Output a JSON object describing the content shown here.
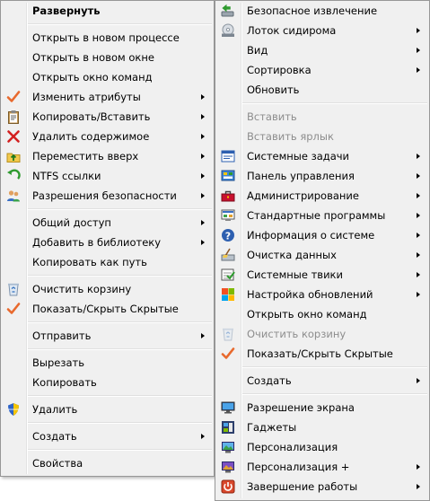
{
  "left_menu": {
    "items": [
      {
        "label": "Развернуть",
        "bold": true
      },
      {
        "sep": true
      },
      {
        "label": "Открыть в новом процессе"
      },
      {
        "label": "Открыть в новом окне"
      },
      {
        "label": "Открыть окно команд"
      },
      {
        "label": "Изменить атрибуты",
        "icon": "checkmark-icon",
        "submenu": true
      },
      {
        "label": "Копировать/Вставить",
        "icon": "clipboard-icon",
        "submenu": true
      },
      {
        "label": "Удалить содержимое",
        "icon": "red-x-icon",
        "submenu": true
      },
      {
        "label": "Переместить вверх",
        "icon": "folder-up-icon",
        "submenu": true
      },
      {
        "label": "NTFS ссылки",
        "icon": "green-arrow-icon",
        "submenu": true
      },
      {
        "label": "Разрешения безопасности",
        "icon": "users-icon",
        "submenu": true
      },
      {
        "sep": true
      },
      {
        "label": "Общий доступ",
        "submenu": true
      },
      {
        "label": "Добавить в библиотеку",
        "submenu": true
      },
      {
        "label": "Копировать как путь"
      },
      {
        "sep": true
      },
      {
        "label": "Очистить корзину",
        "icon": "recycle-bin-icon"
      },
      {
        "label": "Показать/Скрыть Скрытые",
        "icon": "checkmark-icon"
      },
      {
        "sep": true
      },
      {
        "label": "Отправить",
        "submenu": true
      },
      {
        "sep": true
      },
      {
        "label": "Вырезать"
      },
      {
        "label": "Копировать"
      },
      {
        "sep": true
      },
      {
        "label": "Удалить",
        "icon": "shield-icon"
      },
      {
        "sep": true
      },
      {
        "label": "Создать",
        "submenu": true
      },
      {
        "sep": true
      },
      {
        "label": "Свойства"
      }
    ]
  },
  "right_menu": {
    "items": [
      {
        "label": "Безопасное извлечение",
        "icon": "eject-icon"
      },
      {
        "label": "Лоток сидирома",
        "icon": "cd-drive-icon",
        "submenu": true
      },
      {
        "label": "Вид",
        "submenu": true
      },
      {
        "label": "Сортировка",
        "submenu": true
      },
      {
        "label": "Обновить"
      },
      {
        "sep": true
      },
      {
        "label": "Вставить",
        "disabled": true
      },
      {
        "label": "Вставить ярлык",
        "disabled": true
      },
      {
        "label": "Системные задачи",
        "icon": "system-tasks-icon",
        "submenu": true
      },
      {
        "label": "Панель управления",
        "icon": "control-panel-icon",
        "submenu": true
      },
      {
        "label": "Администрирование",
        "icon": "toolbox-icon",
        "submenu": true
      },
      {
        "label": "Стандартные программы",
        "icon": "programs-icon",
        "submenu": true
      },
      {
        "label": "Информация о системе",
        "icon": "info-icon",
        "submenu": true
      },
      {
        "label": "Очистка данных",
        "icon": "cleanup-icon",
        "submenu": true
      },
      {
        "label": "Системные твики",
        "icon": "tweaks-icon",
        "submenu": true
      },
      {
        "label": "Настройка обновлений",
        "icon": "update-settings-icon",
        "submenu": true
      },
      {
        "label": "Открыть окно команд"
      },
      {
        "label": "Очистить корзину",
        "icon": "recycle-bin-icon",
        "disabled": true
      },
      {
        "label": "Показать/Скрыть Скрытые",
        "icon": "checkmark-icon"
      },
      {
        "sep": true
      },
      {
        "label": "Создать",
        "submenu": true
      },
      {
        "sep": true
      },
      {
        "label": "Разрешение экрана",
        "icon": "monitor-icon"
      },
      {
        "label": "Гаджеты",
        "icon": "gadgets-icon"
      },
      {
        "label": "Персонализация",
        "icon": "personalization-icon"
      },
      {
        "label": "Персонализация +",
        "icon": "personalization-plus-icon",
        "submenu": true
      },
      {
        "label": "Завершение работы",
        "icon": "power-icon",
        "submenu": true
      }
    ]
  },
  "colors": {
    "menu_bg": "#f0f0f0",
    "border": "#979797",
    "disabled_text": "#8d8d8d",
    "check": "#e8692d"
  }
}
